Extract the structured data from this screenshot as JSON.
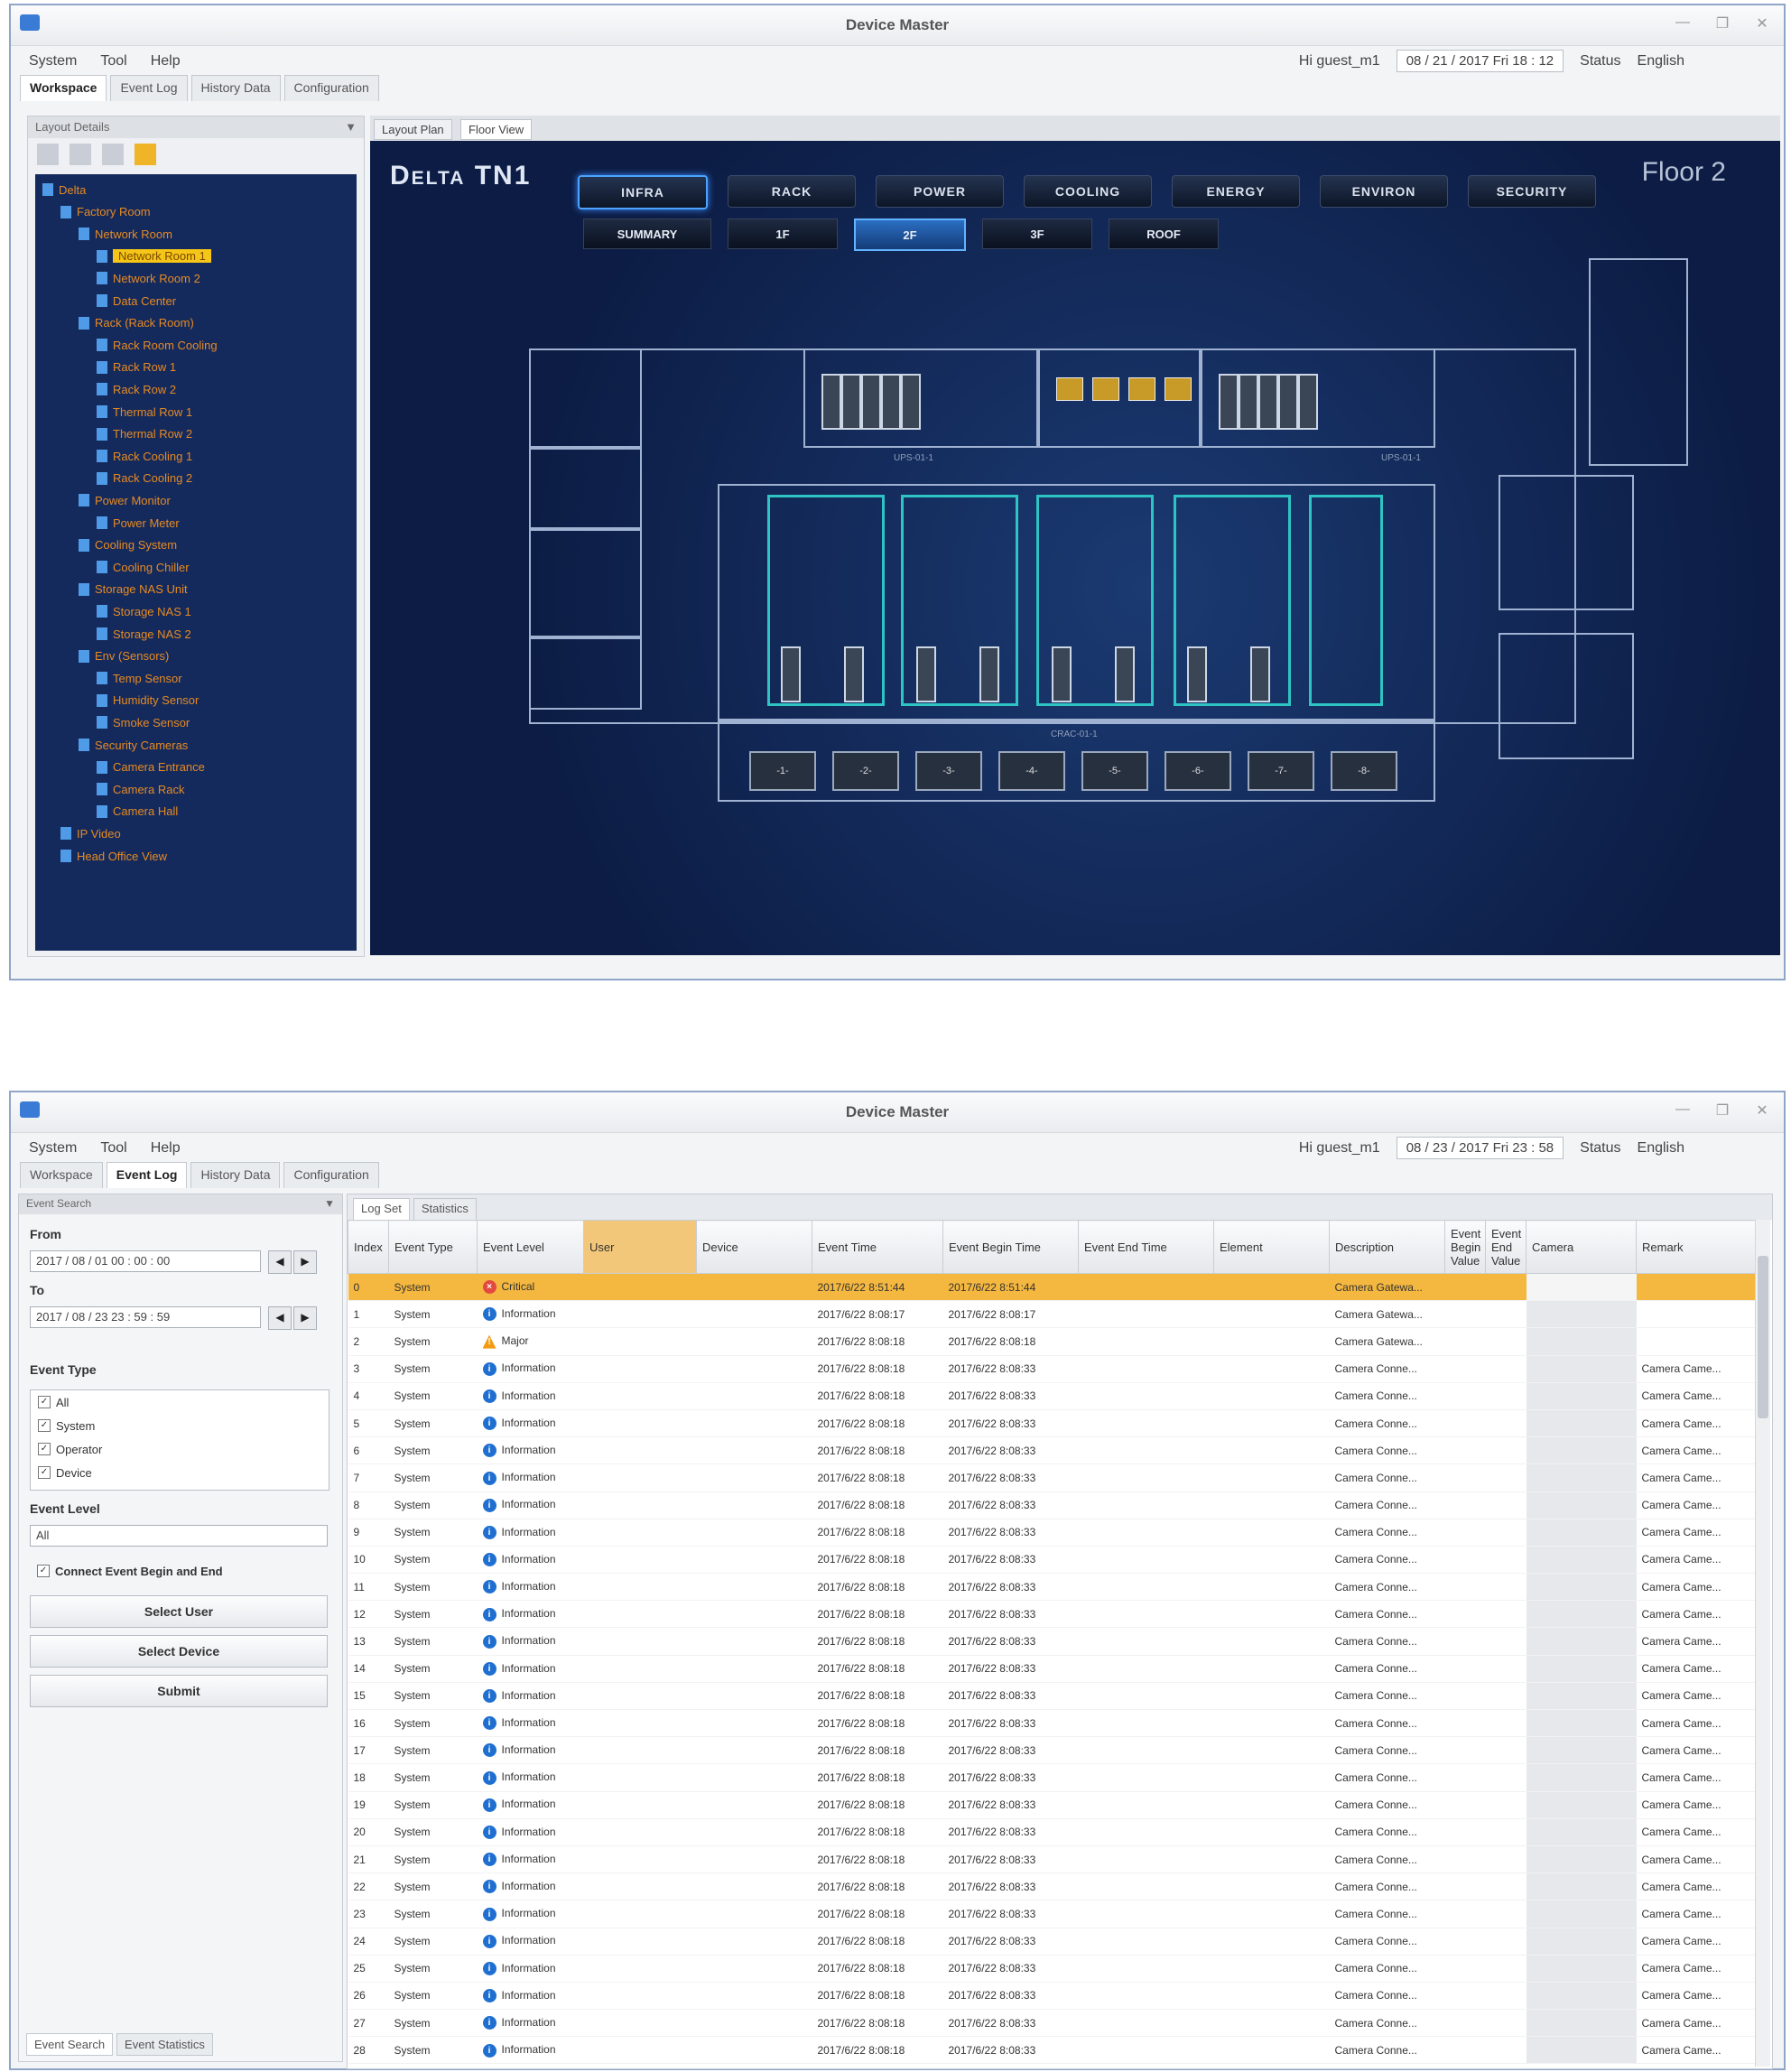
{
  "window1": {
    "title": "Device Master",
    "menu": [
      "System",
      "Tool",
      "Help"
    ],
    "user": "Hi guest_m1",
    "datetime": "08 / 21 / 2017   Fri   18 : 12",
    "status_label": "Status",
    "language": "English",
    "tabs": [
      "Workspace",
      "Event Log",
      "History Data",
      "Configuration"
    ],
    "tree_panel_title": "Layout Details",
    "tree": [
      {
        "indent": 0,
        "label": "Delta",
        "sel": false
      },
      {
        "indent": 1,
        "label": "Factory Room",
        "sel": false
      },
      {
        "indent": 2,
        "label": "Network Room",
        "sel": false
      },
      {
        "indent": 3,
        "label": "Network Room 1",
        "sel": true
      },
      {
        "indent": 3,
        "label": "Network Room 2",
        "sel": false
      },
      {
        "indent": 3,
        "label": "Data Center",
        "sel": false
      },
      {
        "indent": 2,
        "label": "Rack (Rack Room)",
        "sel": false
      },
      {
        "indent": 3,
        "label": "Rack Room Cooling",
        "sel": false
      },
      {
        "indent": 3,
        "label": "Rack Row 1",
        "sel": false
      },
      {
        "indent": 3,
        "label": "Rack Row 2",
        "sel": false
      },
      {
        "indent": 3,
        "label": "Thermal Row 1",
        "sel": false
      },
      {
        "indent": 3,
        "label": "Thermal Row 2",
        "sel": false
      },
      {
        "indent": 3,
        "label": "Rack Cooling 1",
        "sel": false
      },
      {
        "indent": 3,
        "label": "Rack Cooling 2",
        "sel": false
      },
      {
        "indent": 2,
        "label": "Power Monitor",
        "sel": false
      },
      {
        "indent": 3,
        "label": "Power Meter",
        "sel": false
      },
      {
        "indent": 2,
        "label": "Cooling System",
        "sel": false
      },
      {
        "indent": 3,
        "label": "Cooling Chiller",
        "sel": false
      },
      {
        "indent": 2,
        "label": "Storage NAS Unit",
        "sel": false
      },
      {
        "indent": 3,
        "label": "Storage NAS 1",
        "sel": false
      },
      {
        "indent": 3,
        "label": "Storage NAS 2",
        "sel": false
      },
      {
        "indent": 2,
        "label": "Env (Sensors)",
        "sel": false
      },
      {
        "indent": 3,
        "label": "Temp Sensor",
        "sel": false
      },
      {
        "indent": 3,
        "label": "Humidity Sensor",
        "sel": false
      },
      {
        "indent": 3,
        "label": "Smoke Sensor",
        "sel": false
      },
      {
        "indent": 2,
        "label": "Security Cameras",
        "sel": false
      },
      {
        "indent": 3,
        "label": "Camera Entrance",
        "sel": false
      },
      {
        "indent": 3,
        "label": "Camera Rack",
        "sel": false
      },
      {
        "indent": 3,
        "label": "Camera Hall",
        "sel": false
      },
      {
        "indent": 1,
        "label": "IP Video",
        "sel": false
      },
      {
        "indent": 1,
        "label": "Head Office View",
        "sel": false
      }
    ],
    "doc_tabs": [
      "Layout Plan",
      "Floor View"
    ],
    "brand": "Delta TN1",
    "floor_label": "Floor 2",
    "category_buttons": [
      "INFRA",
      "RACK",
      "POWER",
      "COOLING",
      "ENERGY",
      "ENVIRON",
      "SECURITY"
    ],
    "active_category": 0,
    "floor_buttons": [
      "SUMMARY",
      "1F",
      "2F",
      "3F",
      "ROOF"
    ],
    "active_floor": 2,
    "unit_labels": [
      "-1-",
      "-2-",
      "-3-",
      "-4-",
      "-5-",
      "-6-",
      "-7-",
      "-8-"
    ],
    "zone_labels": [
      "UPS-01-1",
      "UPS-01-1",
      "CRAC-01-1"
    ]
  },
  "window2": {
    "title": "Device Master",
    "menu": [
      "System",
      "Tool",
      "Help"
    ],
    "user": "Hi guest_m1",
    "datetime": "08 / 23 / 2017   Fri   23 : 58",
    "status_label": "Status",
    "language": "English",
    "tabs": [
      "Workspace",
      "Event Log",
      "History Data",
      "Configuration"
    ],
    "filter": {
      "panel_title": "Event Search",
      "from_label": "From",
      "from_value": "2017 / 08 / 01   00 : 00 : 00",
      "to_label": "To",
      "to_value": "2017 / 08 / 23   23 : 59 : 59",
      "event_type_label": "Event Type",
      "event_types": [
        "All",
        "System",
        "Operator",
        "Device"
      ],
      "event_level_label": "Event Level",
      "event_level_value": "All",
      "connect_label": "Connect Event Begin and End",
      "buttons": [
        "Select User",
        "Select Device",
        "Submit"
      ],
      "bottom_tabs": [
        "Event Search",
        "Event Statistics"
      ]
    },
    "log": {
      "tabs": [
        "Log Set",
        "Statistics"
      ],
      "columns": [
        "Index",
        "Event Type",
        "Event Level",
        "User",
        "Device",
        "Event Time",
        "Event Begin Time",
        "Event End Time",
        "Element",
        "Description",
        "Event Begin Value",
        "Event End Value",
        "Camera",
        "Remark"
      ],
      "rows": [
        {
          "idx": "0",
          "type": "System",
          "level": "Critical",
          "time": "2017/6/22 8:51:44",
          "begin": "2017/6/22 8:51:44",
          "desc": "Camera Gatewa...",
          "remark": ""
        },
        {
          "idx": "1",
          "type": "System",
          "level": "Information",
          "time": "2017/6/22 8:08:17",
          "begin": "2017/6/22 8:08:17",
          "desc": "Camera Gatewa...",
          "remark": ""
        },
        {
          "idx": "2",
          "type": "System",
          "level": "Major",
          "time": "2017/6/22 8:08:18",
          "begin": "2017/6/22 8:08:18",
          "desc": "Camera Gatewa...",
          "remark": ""
        },
        {
          "idx": "3",
          "type": "System",
          "level": "Information",
          "time": "2017/6/22 8:08:18",
          "begin": "2017/6/22 8:08:33",
          "desc": "Camera Conne...",
          "remark": "Camera Came..."
        },
        {
          "idx": "4",
          "type": "System",
          "level": "Information",
          "time": "2017/6/22 8:08:18",
          "begin": "2017/6/22 8:08:33",
          "desc": "Camera Conne...",
          "remark": "Camera Came..."
        },
        {
          "idx": "5",
          "type": "System",
          "level": "Information",
          "time": "2017/6/22 8:08:18",
          "begin": "2017/6/22 8:08:33",
          "desc": "Camera Conne...",
          "remark": "Camera Came..."
        },
        {
          "idx": "6",
          "type": "System",
          "level": "Information",
          "time": "2017/6/22 8:08:18",
          "begin": "2017/6/22 8:08:33",
          "desc": "Camera Conne...",
          "remark": "Camera Came..."
        },
        {
          "idx": "7",
          "type": "System",
          "level": "Information",
          "time": "2017/6/22 8:08:18",
          "begin": "2017/6/22 8:08:33",
          "desc": "Camera Conne...",
          "remark": "Camera Came..."
        },
        {
          "idx": "8",
          "type": "System",
          "level": "Information",
          "time": "2017/6/22 8:08:18",
          "begin": "2017/6/22 8:08:33",
          "desc": "Camera Conne...",
          "remark": "Camera Came..."
        },
        {
          "idx": "9",
          "type": "System",
          "level": "Information",
          "time": "2017/6/22 8:08:18",
          "begin": "2017/6/22 8:08:33",
          "desc": "Camera Conne...",
          "remark": "Camera Came..."
        },
        {
          "idx": "10",
          "type": "System",
          "level": "Information",
          "time": "2017/6/22 8:08:18",
          "begin": "2017/6/22 8:08:33",
          "desc": "Camera Conne...",
          "remark": "Camera Came..."
        },
        {
          "idx": "11",
          "type": "System",
          "level": "Information",
          "time": "2017/6/22 8:08:18",
          "begin": "2017/6/22 8:08:33",
          "desc": "Camera Conne...",
          "remark": "Camera Came..."
        },
        {
          "idx": "12",
          "type": "System",
          "level": "Information",
          "time": "2017/6/22 8:08:18",
          "begin": "2017/6/22 8:08:33",
          "desc": "Camera Conne...",
          "remark": "Camera Came..."
        },
        {
          "idx": "13",
          "type": "System",
          "level": "Information",
          "time": "2017/6/22 8:08:18",
          "begin": "2017/6/22 8:08:33",
          "desc": "Camera Conne...",
          "remark": "Camera Came..."
        },
        {
          "idx": "14",
          "type": "System",
          "level": "Information",
          "time": "2017/6/22 8:08:18",
          "begin": "2017/6/22 8:08:33",
          "desc": "Camera Conne...",
          "remark": "Camera Came..."
        },
        {
          "idx": "15",
          "type": "System",
          "level": "Information",
          "time": "2017/6/22 8:08:18",
          "begin": "2017/6/22 8:08:33",
          "desc": "Camera Conne...",
          "remark": "Camera Came..."
        },
        {
          "idx": "16",
          "type": "System",
          "level": "Information",
          "time": "2017/6/22 8:08:18",
          "begin": "2017/6/22 8:08:33",
          "desc": "Camera Conne...",
          "remark": "Camera Came..."
        },
        {
          "idx": "17",
          "type": "System",
          "level": "Information",
          "time": "2017/6/22 8:08:18",
          "begin": "2017/6/22 8:08:33",
          "desc": "Camera Conne...",
          "remark": "Camera Came..."
        },
        {
          "idx": "18",
          "type": "System",
          "level": "Information",
          "time": "2017/6/22 8:08:18",
          "begin": "2017/6/22 8:08:33",
          "desc": "Camera Conne...",
          "remark": "Camera Came..."
        },
        {
          "idx": "19",
          "type": "System",
          "level": "Information",
          "time": "2017/6/22 8:08:18",
          "begin": "2017/6/22 8:08:33",
          "desc": "Camera Conne...",
          "remark": "Camera Came..."
        },
        {
          "idx": "20",
          "type": "System",
          "level": "Information",
          "time": "2017/6/22 8:08:18",
          "begin": "2017/6/22 8:08:33",
          "desc": "Camera Conne...",
          "remark": "Camera Came..."
        },
        {
          "idx": "21",
          "type": "System",
          "level": "Information",
          "time": "2017/6/22 8:08:18",
          "begin": "2017/6/22 8:08:33",
          "desc": "Camera Conne...",
          "remark": "Camera Came..."
        },
        {
          "idx": "22",
          "type": "System",
          "level": "Information",
          "time": "2017/6/22 8:08:18",
          "begin": "2017/6/22 8:08:33",
          "desc": "Camera Conne...",
          "remark": "Camera Came..."
        },
        {
          "idx": "23",
          "type": "System",
          "level": "Information",
          "time": "2017/6/22 8:08:18",
          "begin": "2017/6/22 8:08:33",
          "desc": "Camera Conne...",
          "remark": "Camera Came..."
        },
        {
          "idx": "24",
          "type": "System",
          "level": "Information",
          "time": "2017/6/22 8:08:18",
          "begin": "2017/6/22 8:08:33",
          "desc": "Camera Conne...",
          "remark": "Camera Came..."
        },
        {
          "idx": "25",
          "type": "System",
          "level": "Information",
          "time": "2017/6/22 8:08:18",
          "begin": "2017/6/22 8:08:33",
          "desc": "Camera Conne...",
          "remark": "Camera Came..."
        },
        {
          "idx": "26",
          "type": "System",
          "level": "Information",
          "time": "2017/6/22 8:08:18",
          "begin": "2017/6/22 8:08:33",
          "desc": "Camera Conne...",
          "remark": "Camera Came..."
        },
        {
          "idx": "27",
          "type": "System",
          "level": "Information",
          "time": "2017/6/22 8:08:18",
          "begin": "2017/6/22 8:08:33",
          "desc": "Camera Conne...",
          "remark": "Camera Came..."
        },
        {
          "idx": "28",
          "type": "System",
          "level": "Information",
          "time": "2017/6/22 8:08:18",
          "begin": "2017/6/22 8:08:33",
          "desc": "Camera Conne...",
          "remark": "Camera Came..."
        }
      ]
    }
  },
  "colors": {
    "selection": "#f4b73f",
    "info": "#1f6fd1",
    "critical": "#e34a3f",
    "major": "#f39c12",
    "map_bg": "#0c1c44",
    "aisle": "#2ec4c4",
    "tree_text": "#e58a23"
  },
  "icons": {
    "info": "info-circle-icon",
    "critical": "critical-circle-icon",
    "major": "warning-triangle-icon"
  }
}
